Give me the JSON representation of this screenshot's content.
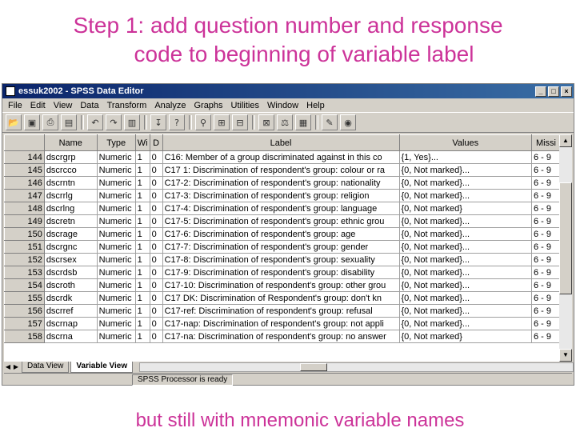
{
  "slide": {
    "title_line1": "Step 1: add question number and response",
    "title_line2": "code to beginning of  variable label",
    "caption": "but still with mnemonic variable names"
  },
  "window": {
    "title": "essuk2002 - SPSS Data Editor",
    "controls": [
      "_",
      "□",
      "×"
    ]
  },
  "menu": [
    "File",
    "Edit",
    "View",
    "Data",
    "Transform",
    "Analyze",
    "Graphs",
    "Utilities",
    "Window",
    "Help"
  ],
  "toolbar_icons": [
    "open-icon",
    "save-icon",
    "print-icon",
    "dialog-recall-icon",
    "undo-icon",
    "redo-icon",
    "goto-chart-icon",
    "goto-case-icon",
    "variables-icon",
    "find-icon",
    "insert-case-icon",
    "insert-variable-icon",
    "split-file-icon",
    "weight-cases-icon",
    "select-cases-icon",
    "value-labels-icon",
    "use-sets-icon"
  ],
  "grid": {
    "columns": [
      "",
      "Name",
      "Type",
      "Wi",
      "D",
      "Label",
      "Values",
      "Missi"
    ],
    "rows": [
      {
        "n": "144",
        "name": "dscrgrp",
        "type": "Numeric",
        "w": "1",
        "d": "0",
        "label": "C16: Member of a group discriminated against in this co",
        "values": "{1, Yes}...",
        "missing": "6 - 9"
      },
      {
        "n": "145",
        "name": "dscrcco",
        "type": "Numeric",
        "w": "1",
        "d": "0",
        "label": "C17 1: Discrimination of respondent's group: colour or ra",
        "values": "{0, Not marked}...",
        "missing": "6 - 9"
      },
      {
        "n": "146",
        "name": "dscrntn",
        "type": "Numeric",
        "w": "1",
        "d": "0",
        "label": "C17-2: Discrimination of respondent's group: nationality",
        "values": "{0, Not marked}...",
        "missing": "6 - 9"
      },
      {
        "n": "147",
        "name": "dscrrlg",
        "type": "Numeric",
        "w": "1",
        "d": "0",
        "label": "C17-3: Discrimination of respondent's group: religion",
        "values": "{0, Not marked}...",
        "missing": "6 - 9"
      },
      {
        "n": "148",
        "name": "dscrlng",
        "type": "Numeric",
        "w": "1",
        "d": "0",
        "label": "C17-4: Discrimination of respondent's group: language",
        "values": "{0, Not marked}",
        "missing": "6 - 9"
      },
      {
        "n": "149",
        "name": "dscretn",
        "type": "Numeric",
        "w": "1",
        "d": "0",
        "label": "C17-5: Discrimination of respondent's group: ethnic grou",
        "values": "{0, Not marked}...",
        "missing": "6 - 9"
      },
      {
        "n": "150",
        "name": "dscrage",
        "type": "Numeric",
        "w": "1",
        "d": "0",
        "label": "C17-6: Discrimination of respondent's group: age",
        "values": "{0, Not marked}...",
        "missing": "6 - 9"
      },
      {
        "n": "151",
        "name": "dscrgnc",
        "type": "Numeric",
        "w": "1",
        "d": "0",
        "label": "C17-7: Discrimination of respondent's group: gender",
        "values": "{0, Not marked}...",
        "missing": "6 - 9"
      },
      {
        "n": "152",
        "name": "dscrsex",
        "type": "Numeric",
        "w": "1",
        "d": "0",
        "label": "C17-8: Discrimination of respondent's group: sexuality",
        "values": "{0, Not marked}...",
        "missing": "6 - 9"
      },
      {
        "n": "153",
        "name": "dscrdsb",
        "type": "Numeric",
        "w": "1",
        "d": "0",
        "label": "C17-9: Discrimination of respondent's group: disability",
        "values": "{0, Not marked}...",
        "missing": "6 - 9"
      },
      {
        "n": "154",
        "name": "dscroth",
        "type": "Numeric",
        "w": "1",
        "d": "0",
        "label": "C17-10: Discrimination of respondent's group: other grou",
        "values": "{0, Not marked}...",
        "missing": "6 - 9"
      },
      {
        "n": "155",
        "name": "dscrdk",
        "type": "Numeric",
        "w": "1",
        "d": "0",
        "label": "C17 DK: Discrimination of Respondent's group: don't kn",
        "values": "{0, Not marked}...",
        "missing": "6 - 9"
      },
      {
        "n": "156",
        "name": "dscrref",
        "type": "Numeric",
        "w": "1",
        "d": "0",
        "label": "C17-ref: Discrimination of respondent's group: refusal",
        "values": "{0, Not marked}...",
        "missing": "6 - 9"
      },
      {
        "n": "157",
        "name": "dscrnap",
        "type": "Numeric",
        "w": "1",
        "d": "0",
        "label": "C17-nap: Discrimination of respondent's group: not appli",
        "values": "{0, Not marked}...",
        "missing": "6 - 9"
      },
      {
        "n": "158",
        "name": "dscrna",
        "type": "Numeric",
        "w": "1",
        "d": "0",
        "label": "C17-na: Discrimination of respondent's group: no answer",
        "values": "{0, Not marked}",
        "missing": "6 - 9"
      }
    ]
  },
  "tabs": [
    "Data View",
    "Variable View"
  ],
  "active_tab": "Variable View",
  "status": "SPSS Processor  is ready"
}
